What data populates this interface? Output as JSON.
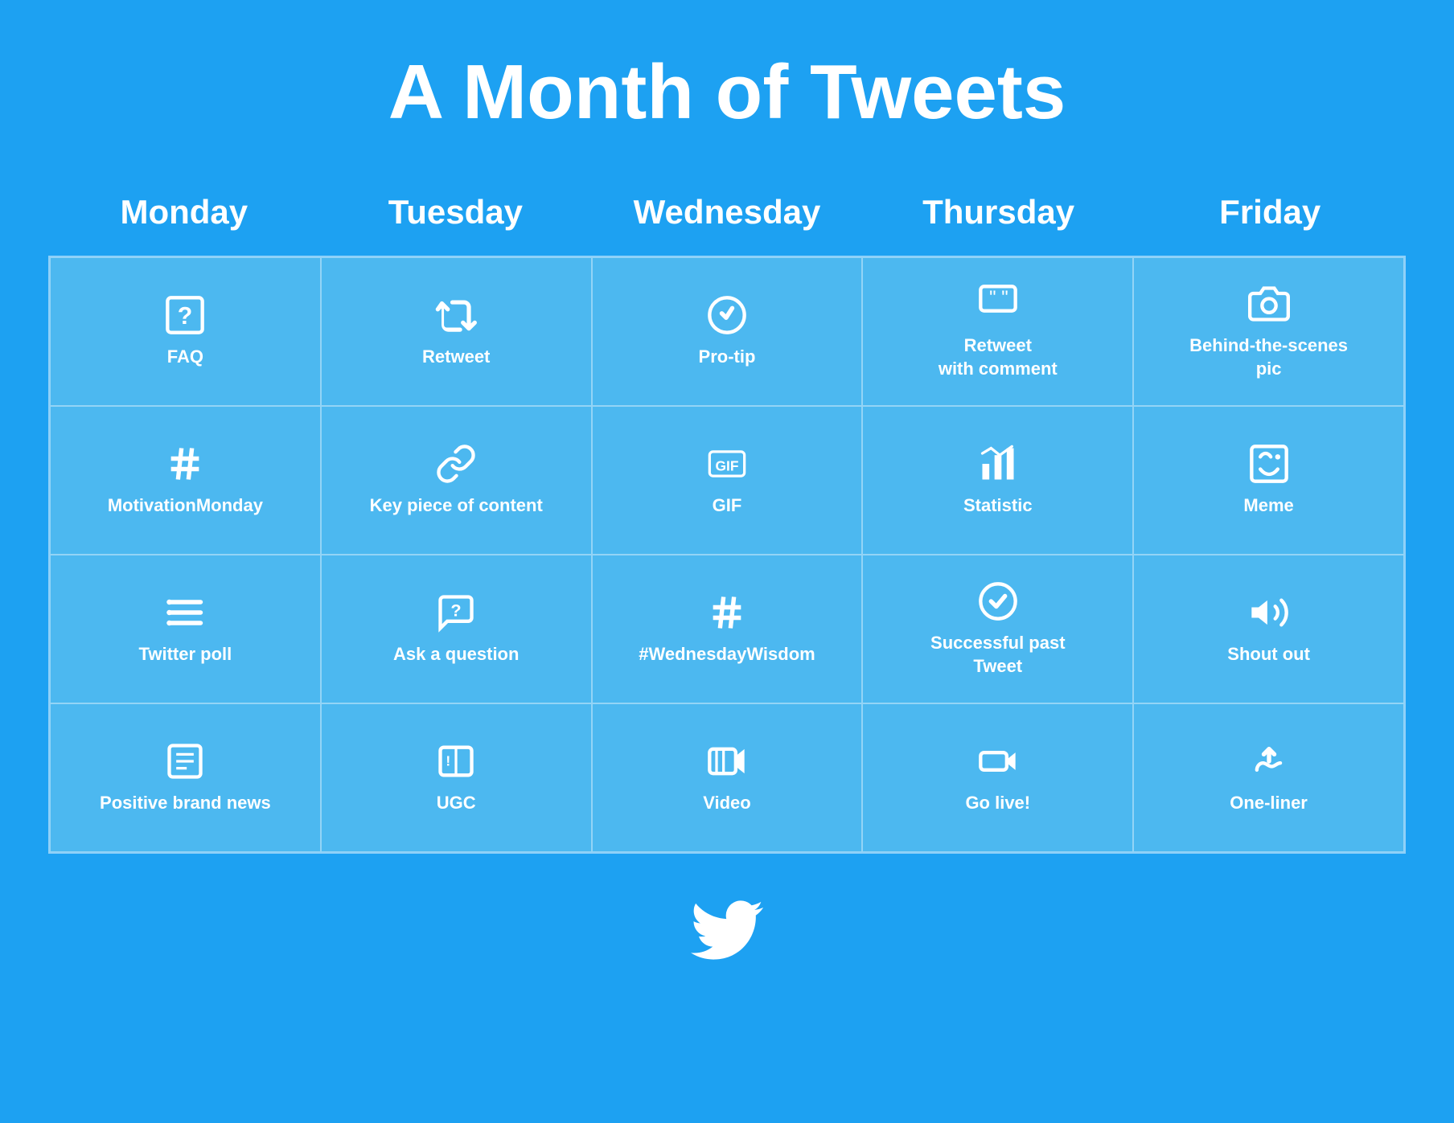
{
  "title": "A Month of Tweets",
  "days": [
    "Monday",
    "Tuesday",
    "Wednesday",
    "Thursday",
    "Friday"
  ],
  "cells": [
    [
      {
        "label": "FAQ",
        "icon": "faq"
      },
      {
        "label": "Retweet",
        "icon": "retweet"
      },
      {
        "label": "Pro-tip",
        "icon": "protip"
      },
      {
        "label": "Retweet\nwith comment",
        "icon": "retweet-comment"
      },
      {
        "label": "Behind-the-scenes\npic",
        "icon": "camera"
      }
    ],
    [
      {
        "label": "MotivationMonday",
        "icon": "hashtag"
      },
      {
        "label": "Key piece of content",
        "icon": "link"
      },
      {
        "label": "GIF",
        "icon": "gif"
      },
      {
        "label": "Statistic",
        "icon": "statistic"
      },
      {
        "label": "Meme",
        "icon": "meme"
      }
    ],
    [
      {
        "label": "Twitter poll",
        "icon": "poll"
      },
      {
        "label": "Ask a question",
        "icon": "question"
      },
      {
        "label": "#WednesdayWisdom",
        "icon": "hashtag"
      },
      {
        "label": "Successful past\nTweet",
        "icon": "checkmark"
      },
      {
        "label": "Shout out",
        "icon": "shoutout"
      }
    ],
    [
      {
        "label": "Positive brand news",
        "icon": "newspaper"
      },
      {
        "label": "UGC",
        "icon": "ugc"
      },
      {
        "label": "Video",
        "icon": "video"
      },
      {
        "label": "Go live!",
        "icon": "golive"
      },
      {
        "label": "One-liner",
        "icon": "oneliner"
      }
    ]
  ]
}
